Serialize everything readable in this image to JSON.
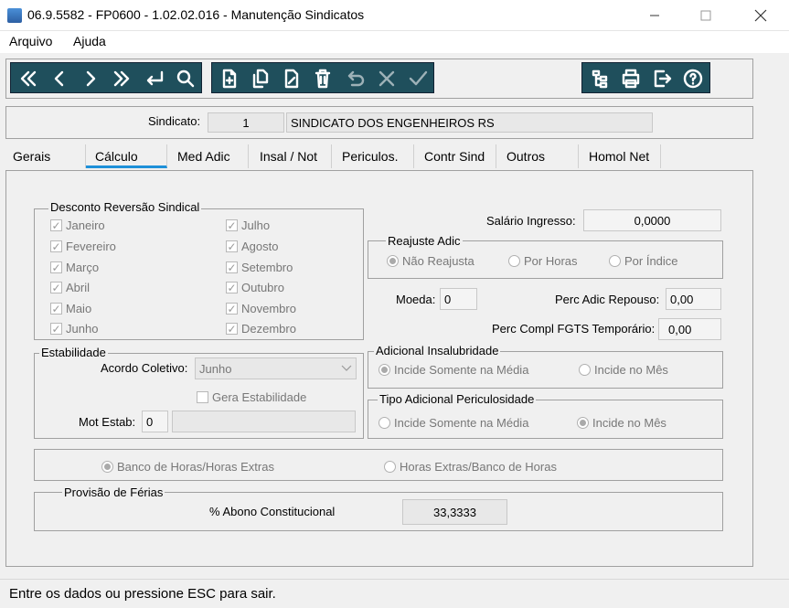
{
  "window": {
    "title": "06.9.5582 - FP0600 - 1.02.02.016 - Manutenção Sindicatos"
  },
  "menu": [
    "Arquivo",
    "Ajuda"
  ],
  "toolbar": {
    "nav": [
      "first-icon",
      "prev-icon",
      "next-icon",
      "last-icon",
      "enter-icon",
      "search-icon"
    ],
    "edit": [
      "new-icon",
      "copy-icon",
      "edit-icon",
      "delete-icon",
      "undo-icon",
      "cancel-icon",
      "confirm-icon"
    ],
    "tools": [
      "tree-icon",
      "print-icon",
      "exit-icon",
      "help-icon"
    ]
  },
  "sindicato": {
    "label": "Sindicato:",
    "code": "1",
    "name": "SINDICATO DOS ENGENHEIROS RS"
  },
  "tabs": [
    "Gerais",
    "Cálculo",
    "Med Adic",
    "Insal / Not",
    "Periculos.",
    "Contr Sind",
    "Outros",
    "Homol Net"
  ],
  "desconto": {
    "title": "Desconto Reversão Sindical",
    "months_left": [
      "Janeiro",
      "Fevereiro",
      "Março",
      "Abril",
      "Maio",
      "Junho"
    ],
    "months_right": [
      "Julho",
      "Agosto",
      "Setembro",
      "Outubro",
      "Novembro",
      "Dezembro"
    ]
  },
  "salario": {
    "label": "Salário Ingresso:",
    "value": "0,0000"
  },
  "reajuste": {
    "title": "Reajuste Adic",
    "options": [
      "Não Reajusta",
      "Por Horas",
      "Por Índice"
    ]
  },
  "moeda": {
    "label": "Moeda:",
    "value": "0"
  },
  "perc_repouso": {
    "label": "Perc Adic Repouso:",
    "value": "0,00"
  },
  "perc_fgts": {
    "label": "Perc Compl FGTS Temporário:",
    "value": "0,00"
  },
  "estabilidade": {
    "title": "Estabilidade",
    "acordo_label": "Acordo Coletivo:",
    "acordo_value": "Junho",
    "gera_label": "Gera Estabilidade",
    "mot_label": "Mot Estab:",
    "mot_value": "0"
  },
  "insalubridade": {
    "title": "Adicional Insalubridade",
    "options": [
      "Incide Somente na Média",
      "Incide no Mês"
    ]
  },
  "periculosidade": {
    "title": "Tipo Adicional Periculosidade",
    "options": [
      "Incide Somente na Média",
      "Incide no Mês"
    ]
  },
  "banco": {
    "options": [
      "Banco de Horas/Horas Extras",
      "Horas Extras/Banco de Horas"
    ]
  },
  "ferias": {
    "title": "Provisão de Férias",
    "abono_label": "% Abono Constitucional",
    "abono_value": "33,3333"
  },
  "status": "Entre os dados ou pressione ESC para sair."
}
